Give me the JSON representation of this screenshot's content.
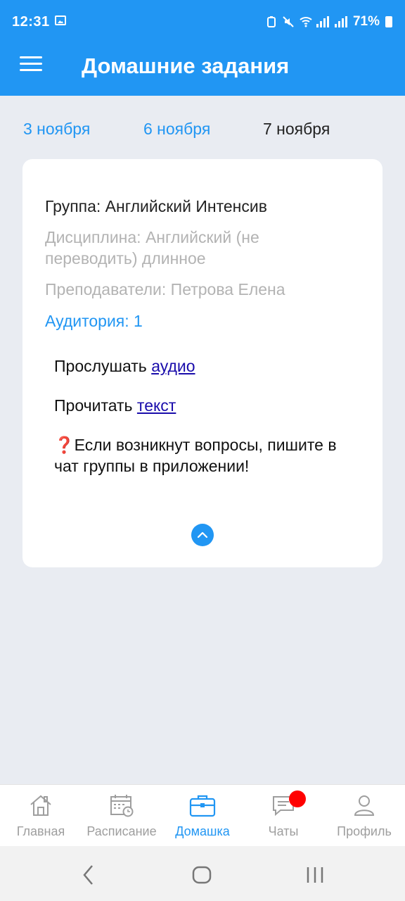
{
  "status": {
    "time": "12:31",
    "battery": "71%"
  },
  "header": {
    "title": "Домашние задания",
    "menu_icon": "hamburger-icon"
  },
  "dates": [
    "3 ноября",
    "6 ноября",
    "7 ноября"
  ],
  "selected_date": "7 ноября",
  "card": {
    "group": "Группа: Английский Интенсив",
    "discipline": "Дисциплина: Английский (не переводить) длинное",
    "teachers": "Преподаватели: Петрова Елена",
    "room": "Аудитория: 1",
    "listen_prefix": "Прослушать ",
    "listen_link": "аудио",
    "read_prefix": "Прочитать ",
    "read_link": "текст",
    "question_mark": "❓",
    "note": "Если возникнут вопросы, пишите в чат группы в приложении!"
  },
  "bottom_nav": [
    {
      "label": "Главная",
      "icon": "home-icon"
    },
    {
      "label": "Расписание",
      "icon": "calendar-icon"
    },
    {
      "label": "Домашка",
      "icon": "briefcase-icon"
    },
    {
      "label": "Чаты",
      "icon": "chat-icon"
    },
    {
      "label": "Профиль",
      "icon": "profile-icon"
    }
  ],
  "active_nav": "Домашка",
  "colors": {
    "accent": "#2196f3",
    "badge": "#ff0000",
    "background": "#e9ecf2"
  }
}
